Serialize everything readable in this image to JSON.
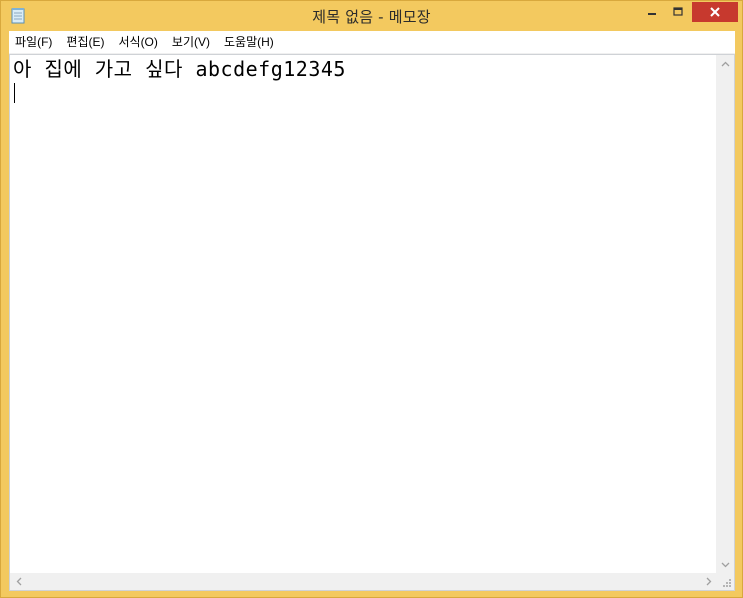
{
  "window": {
    "title": "제목 없음 - 메모장"
  },
  "menu": {
    "items": [
      "파일(F)",
      "편집(E)",
      "서식(O)",
      "보기(V)",
      "도움말(H)"
    ]
  },
  "editor": {
    "text": "아 집에 가고 싶다 abcdefg12345"
  },
  "icons": {
    "app": "notepad-icon",
    "minimize": "minimize-icon",
    "maximize": "maximize-icon",
    "close": "close-icon",
    "scroll_up": "chevron-up-icon",
    "scroll_down": "chevron-down-icon",
    "scroll_left": "chevron-left-icon",
    "scroll_right": "chevron-right-icon",
    "resize_grip": "resize-grip-icon"
  },
  "colors": {
    "frame": "#f3c95f",
    "close_button": "#c7392e",
    "editor_background": "#ffffff"
  }
}
